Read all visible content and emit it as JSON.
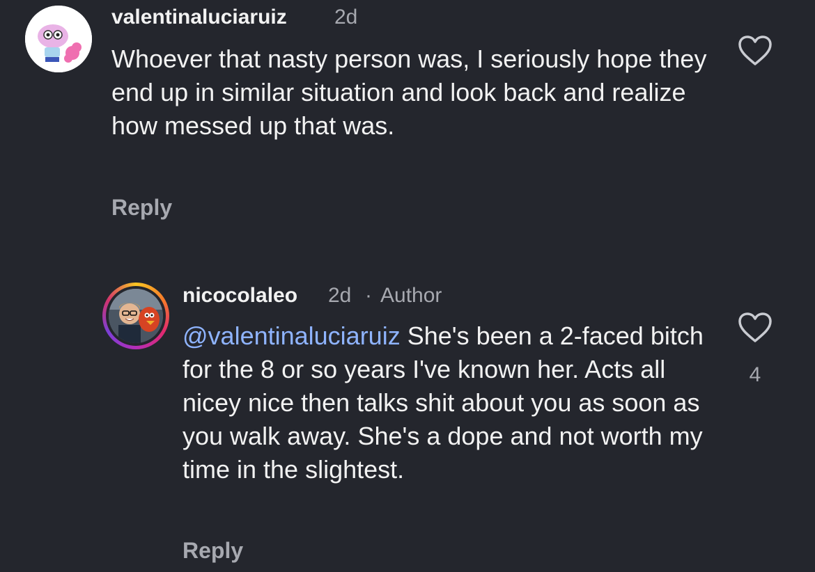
{
  "comments": [
    {
      "username": "valentinaluciaruiz",
      "time": "2d",
      "text": "Whoever that nasty person was, I seriously hope they end up in similar situation and look back and realize how messed up that was.",
      "reply_label": "Reply"
    },
    {
      "username": "nicocolaleo",
      "time": "2d",
      "separator": "·",
      "author_badge": "Author",
      "mention": "@valentinaluciaruiz",
      "text": " She's been a 2-faced bitch for the 8 or so years I've known her. Acts all nicey nice then talks shit about you as soon as you walk away. She's a dope and not worth my time in the slightest.",
      "reply_label": "Reply",
      "like_count": "4"
    }
  ],
  "icons": {
    "like": "heart-outline-icon"
  },
  "colors": {
    "background": "#24262d",
    "text": "#f2f2f2",
    "muted": "#a7a9b0",
    "mention": "#8fb4ff"
  }
}
